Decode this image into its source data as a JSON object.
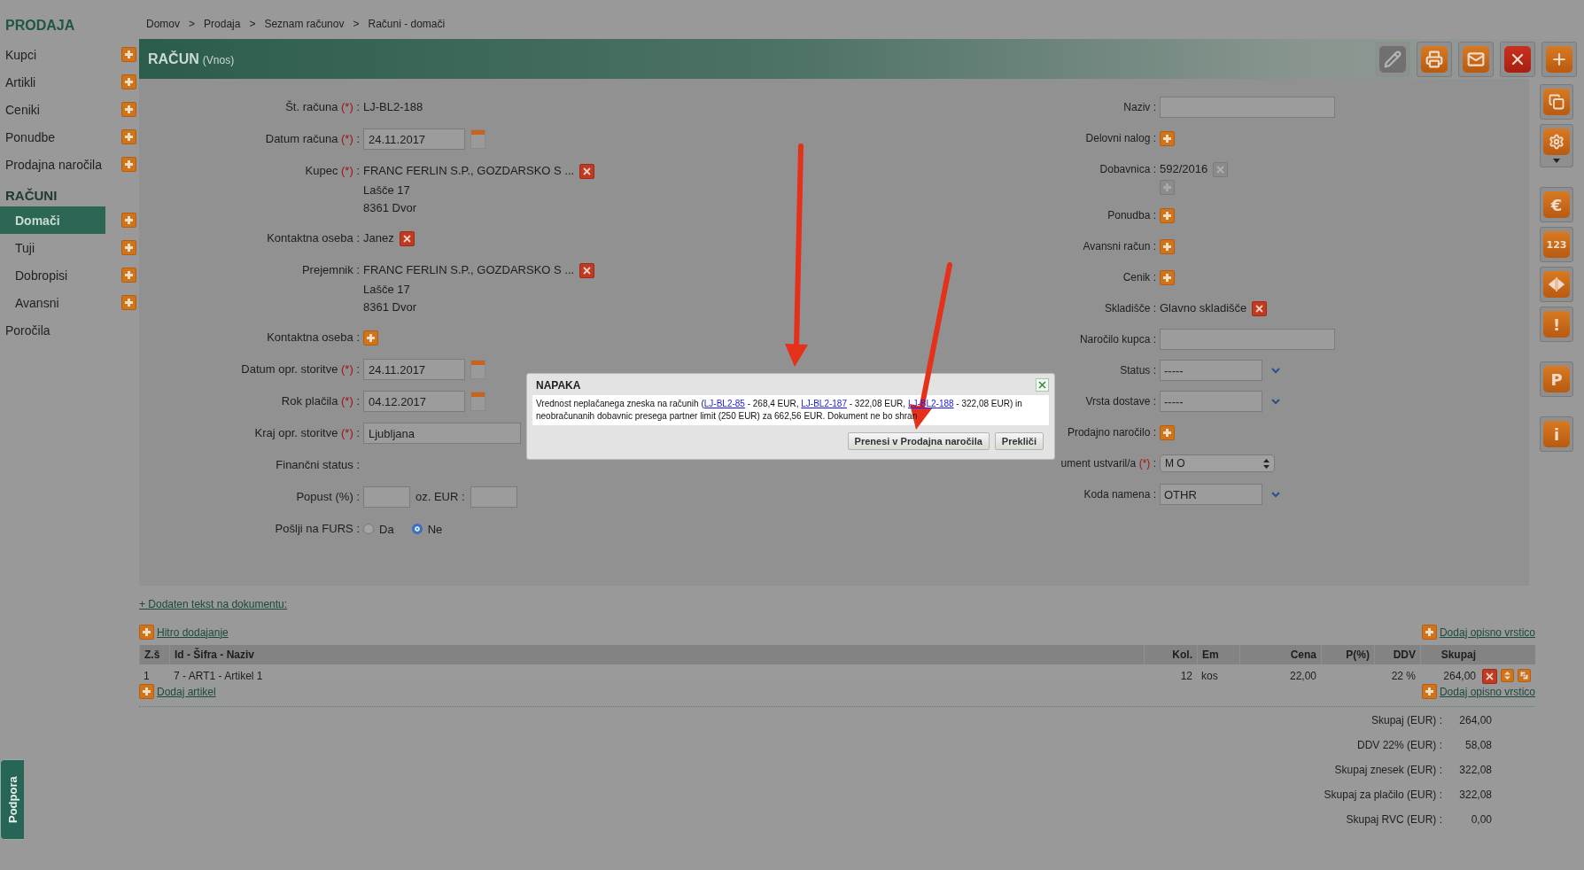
{
  "sidebar": {
    "title": "PRODAJA",
    "items": [
      {
        "kind": "link",
        "label": "Kupci",
        "selected": false,
        "add": true
      },
      {
        "kind": "link",
        "label": "Artikli",
        "selected": false,
        "add": true
      },
      {
        "kind": "link",
        "label": "Ceniki",
        "selected": false,
        "add": true
      },
      {
        "kind": "link",
        "label": "Ponudbe",
        "selected": false,
        "add": true
      },
      {
        "kind": "link",
        "label": "Prodajna naročila",
        "selected": false,
        "add": true
      },
      {
        "kind": "group",
        "label": "RAČUNI",
        "children": [
          {
            "kind": "link",
            "label": "Domači",
            "selected": true,
            "add": true
          },
          {
            "kind": "link",
            "label": "Tuji",
            "selected": false,
            "add": true
          },
          {
            "kind": "link",
            "label": "Dobropisi",
            "selected": false,
            "add": true
          },
          {
            "kind": "link",
            "label": "Avansni",
            "selected": false,
            "add": true
          }
        ]
      },
      {
        "kind": "link",
        "label": "Poročila",
        "selected": false,
        "add": false
      }
    ]
  },
  "breadcrumb": {
    "separator": ">",
    "items": [
      "Domov",
      "Prodaja",
      "Seznam računov",
      "Računi - domači"
    ]
  },
  "header": {
    "title": "RAČUN",
    "subtitle": "(Vnos)"
  },
  "toolbar": [
    {
      "kind": "edit",
      "disabled": true
    },
    {
      "kind": "print",
      "disabled": false
    },
    {
      "kind": "mail",
      "disabled": false
    },
    {
      "kind": "delete",
      "disabled": false
    },
    {
      "kind": "add",
      "disabled": false
    }
  ],
  "side_tools": [
    [
      {
        "kind": "copy"
      },
      {
        "kind": "settings",
        "menu": true
      }
    ],
    [
      {
        "kind": "glyph",
        "text": "€"
      },
      {
        "kind": "glyph",
        "text": "123"
      },
      {
        "kind": "split"
      },
      {
        "kind": "glyph",
        "text": "!"
      }
    ],
    [
      {
        "kind": "glyph",
        "text": "P"
      }
    ],
    [
      {
        "kind": "glyph",
        "text": "i"
      }
    ]
  ],
  "form": {
    "left": [
      {
        "label": "Št. računa",
        "mark": "(*)",
        "colon": ":",
        "kind": "text",
        "value": "LJ-BL2-188"
      },
      {
        "label": "Datum računa",
        "mark": "(*)",
        "colon": ":",
        "kind": "date",
        "value": "24.11.2017"
      },
      {
        "label": "Kupec",
        "mark": "(*)",
        "colon": ":",
        "kind": "party",
        "lines": [
          "FRANC FERLIN S.P., GOZDARSKO S ...",
          "Lašče 17",
          "8361 Dvor"
        ]
      },
      {
        "label": "Kontaktna oseba",
        "colon": ":",
        "kind": "contact",
        "value": "Janez"
      },
      {
        "label": "Prejemnik",
        "colon": ":",
        "kind": "party",
        "lines": [
          "FRANC FERLIN S.P., GOZDARSKO S ...",
          "Lašče 17",
          "8361 Dvor"
        ]
      },
      {
        "label": "Kontaktna oseba",
        "colon": ":",
        "kind": "add"
      },
      {
        "label": "Datum opr. storitve",
        "mark": "(*)",
        "colon": ":",
        "kind": "date",
        "value": "24.11.2017"
      },
      {
        "label": "Rok plačila",
        "mark": "(*)",
        "colon": ":",
        "kind": "date",
        "value": "04.12.2017"
      },
      {
        "label": "Kraj opr. storitve",
        "mark": "(*)",
        "colon": ":",
        "kind": "input",
        "value": "Ljubljana"
      },
      {
        "label": "Finančni status",
        "colon": ":",
        "kind": "empty"
      },
      {
        "label": "Popust (%)",
        "colon": ":",
        "kind": "pair",
        "second_label": "oz. EUR :"
      },
      {
        "label": "Pošlji na FURS",
        "colon": ":",
        "kind": "radio",
        "options": [
          {
            "label": "Da",
            "selected": false
          },
          {
            "label": "Ne",
            "selected": true
          }
        ]
      }
    ],
    "right": [
      {
        "label": "Naziv",
        "colon": ":",
        "kind": "input"
      },
      {
        "label": "Delovni nalog",
        "colon": ":",
        "kind": "add"
      },
      {
        "label": "Dobavnica",
        "colon": ":",
        "kind": "doc",
        "value": "592/2016",
        "locked": true
      },
      {
        "label": "Ponudba",
        "colon": ":",
        "kind": "add"
      },
      {
        "label": "Avansni račun",
        "colon": ":",
        "kind": "add"
      },
      {
        "label": "Cenik",
        "colon": ":",
        "kind": "add"
      },
      {
        "label": "Skladišče",
        "colon": ":",
        "kind": "contact",
        "value": "Glavno skladišče"
      },
      {
        "label": "Naročilo kupca",
        "colon": ":",
        "kind": "input"
      },
      {
        "label": "Status",
        "colon": ":",
        "kind": "select",
        "value": "-----"
      },
      {
        "label": "Vrsta dostave",
        "colon": ":",
        "kind": "select",
        "value": "-----"
      },
      {
        "label": "Prodajno naročilo",
        "colon": ":",
        "kind": "add"
      },
      {
        "label": "ument ustvaril/a",
        "mark": "(*)",
        "colon": ":",
        "kind": "native_select",
        "value": "M O"
      },
      {
        "label": "Koda namena",
        "colon": ":",
        "kind": "select",
        "value": "OTHR"
      }
    ]
  },
  "extra_text_link": "+ Dodaten tekst na dokumentu:",
  "quick_add": "Hitro dodajanje",
  "add_description_row_top": "Dodaj opisno vrstico",
  "table": {
    "columns": [
      "Z.š",
      "Id - Šifra - Naziv",
      "Kol.",
      "Em",
      "Cena",
      "P(%)",
      "DDV",
      "Skupaj"
    ],
    "rows": [
      {
        "no": "1",
        "item": "7 - ART1 - Artikel 1",
        "qty": "12",
        "unit": "kos",
        "price": "22,00",
        "vat": "22 %",
        "total": "264,00"
      }
    ]
  },
  "add_article": "Dodaj artikel",
  "add_description_row_bottom": "Dodaj opisno vrstico",
  "totals": [
    {
      "label": "Skupaj (EUR) :",
      "value": "264,00"
    },
    {
      "label": "DDV 22% (EUR) :",
      "value": "58,08"
    },
    {
      "label": "Skupaj znesek (EUR) :",
      "value": "322,08"
    },
    {
      "label": "Skupaj za plačilo (EUR) :",
      "value": "322,08"
    },
    {
      "label": "Skupaj RVC (EUR) :",
      "value": "0,00"
    }
  ],
  "support_tab": "Podpora",
  "dialog": {
    "title": "NAPAKA",
    "message": [
      {
        "kind": "text",
        "text": "Vrednost neplačanega zneska na računih ("
      },
      {
        "kind": "link",
        "text": "LJ-BL2-85"
      },
      {
        "kind": "text",
        "text": " - 268,4 EUR, "
      },
      {
        "kind": "link",
        "text": "LJ-BL2-187"
      },
      {
        "kind": "text",
        "text": " - 322,08 EUR, "
      },
      {
        "kind": "link",
        "text": "LJ-BL2-188"
      },
      {
        "kind": "text",
        "text": " - 322,08 EUR) in neobračunanih dobavnic presega partner limit (250 EUR) za 662,56 EUR. Dokument ne bo shran"
      }
    ],
    "buttons": [
      "Prenesi v Prodajna naročila",
      "Prekliči"
    ]
  }
}
